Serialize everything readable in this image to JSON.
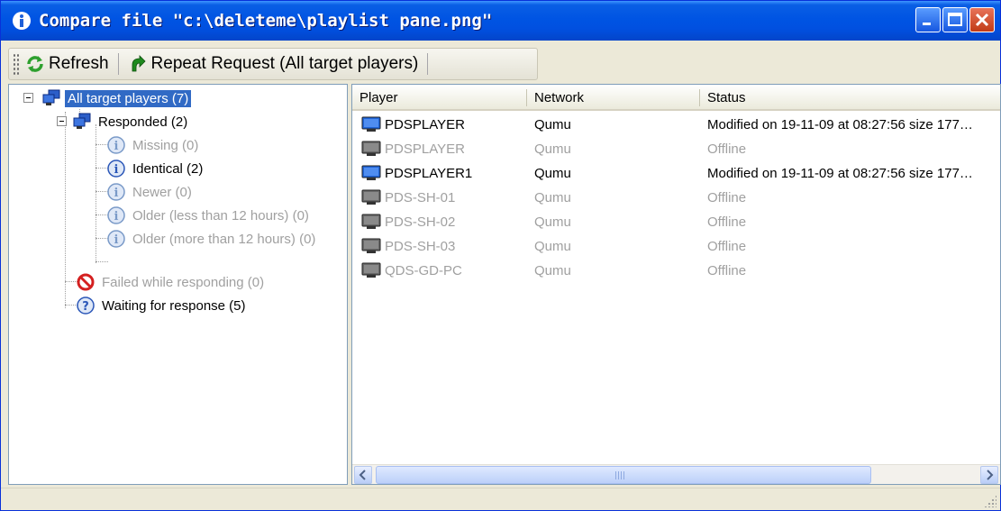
{
  "window": {
    "title": "Compare file \"c:\\deleteme\\playlist pane.png\"",
    "icon": "info-icon",
    "buttons": [
      "minimize",
      "maximize",
      "close"
    ]
  },
  "toolbar": {
    "refresh_label": "Refresh",
    "repeat_label": "Repeat Request (All target players)"
  },
  "tree": {
    "root": "All target players (7)",
    "responded": "Responded (2)",
    "missing": "Missing (0)",
    "identical": "Identical (2)",
    "newer": "Newer (0)",
    "older_less": "Older (less than 12 hours) (0)",
    "older_more": "Older (more than 12 hours) (0)",
    "failed": "Failed while responding (0)",
    "waiting": "Waiting for response (5)"
  },
  "list": {
    "columns": [
      "Player",
      "Network",
      "Status"
    ],
    "rows": [
      {
        "player": "PDSPLAYER",
        "network": "Qumu",
        "status": "Modified on 19-11-09 at 08:27:56 size 177…",
        "online": true
      },
      {
        "player": "PDSPLAYER",
        "network": "Qumu",
        "status": "Offline",
        "online": false
      },
      {
        "player": "PDSPLAYER1",
        "network": "Qumu",
        "status": "Modified on 19-11-09 at 08:27:56 size 177…",
        "online": true
      },
      {
        "player": "PDS-SH-01",
        "network": "Qumu",
        "status": "Offline",
        "online": false
      },
      {
        "player": "PDS-SH-02",
        "network": "Qumu",
        "status": "Offline",
        "online": false
      },
      {
        "player": "PDS-SH-03",
        "network": "Qumu",
        "status": "Offline",
        "online": false
      },
      {
        "player": "QDS-GD-PC",
        "network": "Qumu",
        "status": "Offline",
        "online": false
      }
    ]
  },
  "colors": {
    "titlebar": "#0054e3",
    "selection": "#316ac5",
    "dim_text": "#a0a0a0"
  }
}
